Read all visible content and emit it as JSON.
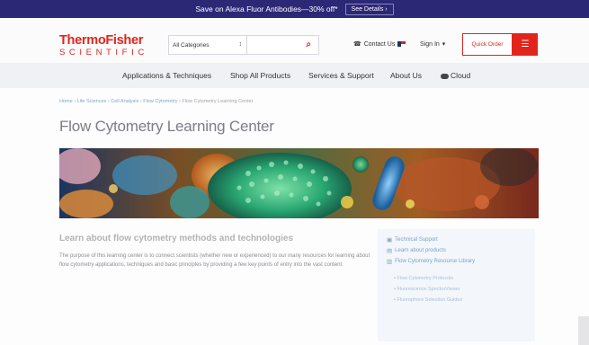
{
  "promo": {
    "text": "Save on Alexa Fluor Antibodies—30% off*",
    "button": "See Details ›"
  },
  "logo": {
    "line1": "ThermoFisher",
    "line2": "SCIENTIFIC"
  },
  "search": {
    "category": "All Categories",
    "caret": "↕",
    "icon": "⌕"
  },
  "utility": {
    "contact": "Contact Us",
    "contact_icon": "☎",
    "sign_in": "Sign In",
    "sign_in_caret": "▾",
    "quick_order": "Quick Order",
    "cart_icon": "☰"
  },
  "nav": {
    "items": [
      {
        "label": "Applications & Techniques"
      },
      {
        "label": "Shop All Products"
      },
      {
        "label": "Services & Support"
      },
      {
        "label": "About Us"
      },
      {
        "label": "Cloud"
      }
    ]
  },
  "breadcrumb": {
    "items": [
      "Home",
      "Life Sciences",
      "Cell Analysis",
      "Flow Cytometry"
    ],
    "separator": "›",
    "current": "Flow Cytometry Learning Center"
  },
  "page": {
    "title": "Flow Cytometry Learning Center"
  },
  "learn": {
    "heading": "Learn about flow cytometry methods and technologies",
    "body": "The purpose of this learning center is to connect scientists (whether new or experienced) to our many resources for learning about flow cytometry applications, techniques and basic principles by providing a few key points of entry into the vast content."
  },
  "sidebar": {
    "links": [
      {
        "label": "Technical Support",
        "icon": "▣"
      },
      {
        "label": "Learn about products",
        "icon": "▤"
      },
      {
        "label": "Flow Cytometry Resource Library",
        "icon": "▥"
      }
    ],
    "bullet": "•",
    "sublinks": [
      {
        "label": "Flow Cytometry Protocols"
      },
      {
        "label": "Fluorescence SpectraViewer"
      },
      {
        "label": "Fluorophore Selection Guides"
      }
    ]
  },
  "colors": {
    "brand_red": "#e1251b",
    "promo_navy": "#2b2876",
    "link_blue": "#7ea2c6"
  }
}
